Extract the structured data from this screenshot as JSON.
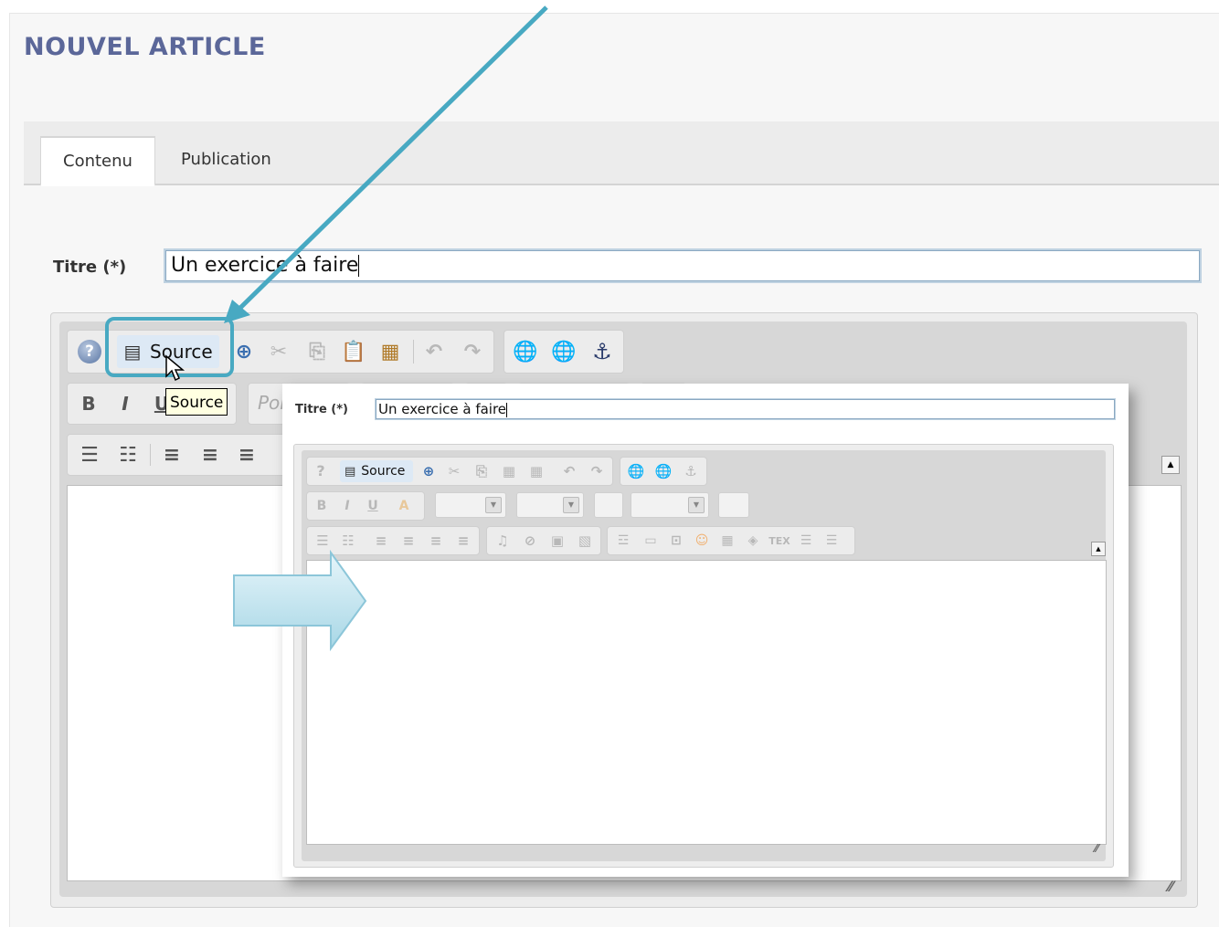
{
  "page": {
    "title": "NOUVEL ARTICLE"
  },
  "tabs": [
    {
      "label": "Contenu"
    },
    {
      "label": "Publication"
    }
  ],
  "form": {
    "title_label": "Titre (*)",
    "title_value": "Un exercice à faire"
  },
  "toolbar": {
    "source_label": "Source",
    "tooltip": "Source",
    "font_placeholder": "Pol",
    "bold": "B",
    "italic": "I",
    "underline": "U"
  },
  "inset": {
    "title_label": "Titre (*)",
    "title_value": "Un exercice à faire",
    "source_label": "Source",
    "bold": "B",
    "italic": "I",
    "underline": "U"
  },
  "colors": {
    "accent": "#48a9c2",
    "title": "#5b6799",
    "arrow_fill": "#cfeaf3"
  },
  "icons": [
    "help-icon",
    "source-icon",
    "maximize-icon",
    "cut-icon",
    "copy-icon",
    "paste-icon",
    "paste-word-icon",
    "undo-icon",
    "redo-icon",
    "link-icon",
    "unlink-icon",
    "anchor-icon",
    "numbered-list-icon",
    "bullet-list-icon",
    "align-left-icon",
    "align-center-icon",
    "align-right-icon",
    "resize-grip-icon",
    "mouse-cursor-icon"
  ]
}
